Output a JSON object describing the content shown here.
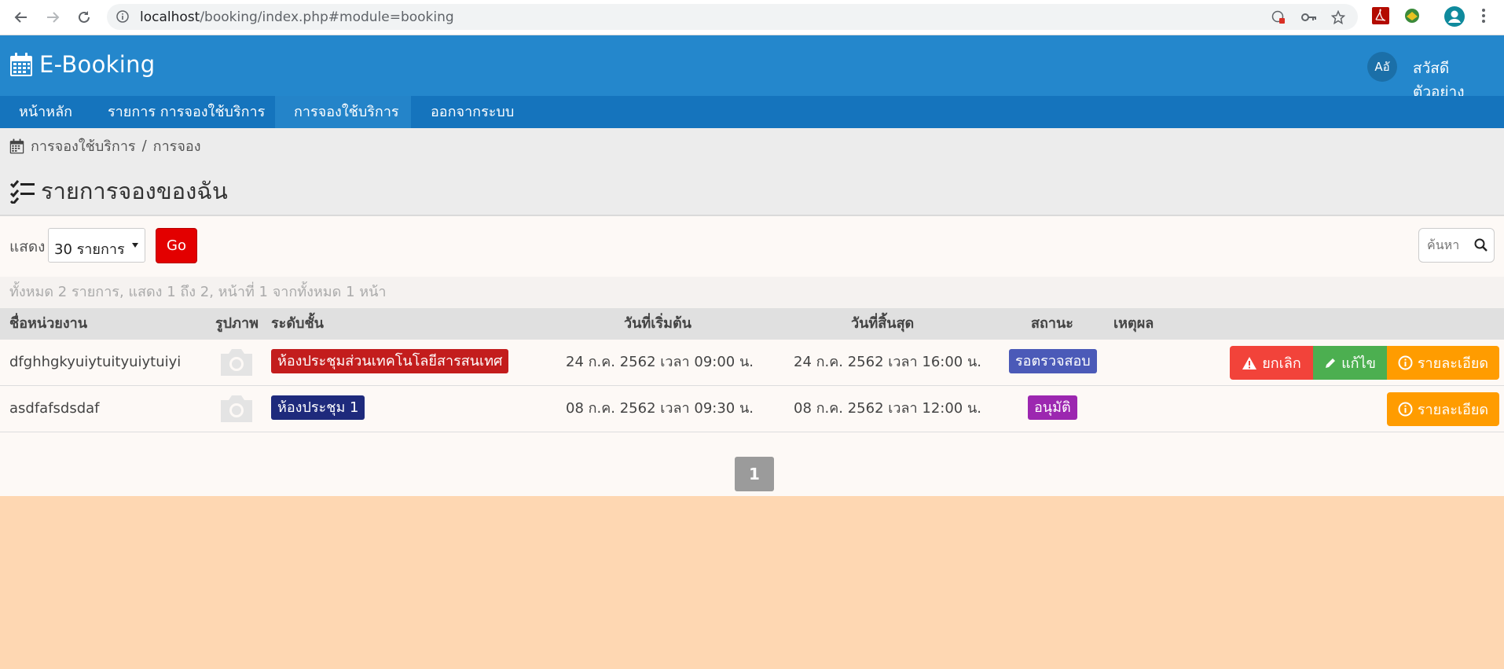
{
  "browser": {
    "url_host": "localhost",
    "url_path": "/booking/index.php#module=booking"
  },
  "header": {
    "brand": "E-Booking",
    "lang_button": "Aอั",
    "user_greeting": "สวัสดี ตัวอย่าง"
  },
  "nav": {
    "items": [
      {
        "label": "หน้าหลัก"
      },
      {
        "label": "รายการ การจองใช้บริการ"
      },
      {
        "label": "การจองใช้บริการ"
      },
      {
        "label": "ออกจากระบบ"
      }
    ]
  },
  "breadcrumb": {
    "parent": "การจองใช้บริการ",
    "separator": "/",
    "current": "การจอง"
  },
  "page": {
    "title": "รายการจองของฉัน"
  },
  "filter": {
    "show_label": "แสดง",
    "limit_value": "30 รายการ",
    "go_label": "Go",
    "search_placeholder": "ค้นหา"
  },
  "summary": "ทั้งหมด 2 รายการ, แสดง 1 ถึง 2, หน้าที่ 1 จากทั้งหมด 1 หน้า",
  "table": {
    "columns": [
      "ชื่อหน่วยงาน",
      "รูปภาพ",
      "ระดับชั้น",
      "วันที่เริ่มต้น",
      "วันที่สิ้นสุด",
      "สถานะ",
      "เหตุผล"
    ],
    "rows": [
      {
        "department": "dfghhgkyuiytuityuiytuiyi",
        "category": "ห้องประชุมส่วนเทคโนโลยีสารสนเทศ",
        "category_color": "#c31d1d",
        "start": "24 ก.ค. 2562 เวลา 09:00 น.",
        "end": "24 ก.ค. 2562 เวลา 16:00 น.",
        "status": "รอตรวจสอบ",
        "status_color": "#4b5ab8",
        "reason": "",
        "actions": {
          "cancel": "ยกเลิก",
          "edit": "แก้ไข",
          "detail": "รายละเอียด"
        }
      },
      {
        "department": "asdfafsdsdaf",
        "category": "ห้องประชุม 1",
        "category_color": "#1e2a7c",
        "start": "08 ก.ค. 2562 เวลา 09:30 น.",
        "end": "08 ก.ค. 2562 เวลา 12:00 น.",
        "status": "อนุมัติ",
        "status_color": "#9c27b0",
        "reason": "",
        "actions": {
          "detail": "รายละเอียด"
        }
      }
    ]
  },
  "pagination": {
    "current": "1"
  },
  "colors": {
    "header_bg": "#2487cc",
    "nav_bg": "#1574bd",
    "page_bg": "#fed7b2",
    "cancel": "#f2433a",
    "edit": "#4caf50",
    "detail": "#ff9c00",
    "go": "#e30000"
  }
}
